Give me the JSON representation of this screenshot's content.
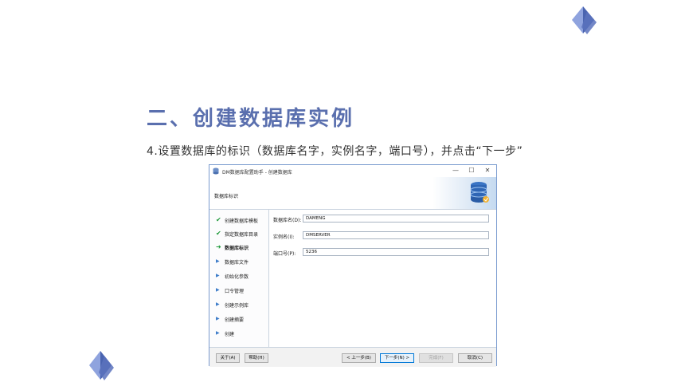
{
  "slide": {
    "title": "二、创建数据库实例",
    "description": "4.设置数据库的标识（数据库名字，实例名字，端口号），并点击“下一步”"
  },
  "colors": {
    "title": "#5a6fae",
    "diamond_light": "#8fa3de",
    "diamond_dark": "#4a64b0"
  },
  "window": {
    "title": "DM数据库配置助手 - 创建数据库",
    "controls": {
      "minimize": "—",
      "maximize": "☐",
      "close": "✕"
    },
    "step_title": "数据库标识",
    "steps": [
      {
        "label": "创建数据库模板",
        "state": "done",
        "icon": "check-icon"
      },
      {
        "label": "指定数据库目录",
        "state": "done",
        "icon": "check-icon"
      },
      {
        "label": "数据库标识",
        "state": "current",
        "icon": "arrow-right-icon"
      },
      {
        "label": "数据库文件",
        "state": "todo",
        "icon": "triangle-right-icon"
      },
      {
        "label": "初始化参数",
        "state": "todo",
        "icon": "triangle-right-icon"
      },
      {
        "label": "口令管理",
        "state": "todo",
        "icon": "triangle-right-icon"
      },
      {
        "label": "创建示例库",
        "state": "todo",
        "icon": "triangle-right-icon"
      },
      {
        "label": "创建摘要",
        "state": "todo",
        "icon": "triangle-right-icon"
      },
      {
        "label": "创建",
        "state": "todo",
        "icon": "triangle-right-icon"
      }
    ],
    "fields": {
      "db_name": {
        "label": "数据库名(D):",
        "value": "DAMENG"
      },
      "instance_name": {
        "label": "实例名(I):",
        "value": "DMSERVER"
      },
      "port": {
        "label": "端口号(P):",
        "value": "5236"
      }
    },
    "buttons": {
      "about": "关于(A)",
      "help": "帮助(H)",
      "back": "< 上一步(B)",
      "next": "下一步(N) >",
      "finish": "完成(F)",
      "cancel": "取消(C)"
    }
  }
}
